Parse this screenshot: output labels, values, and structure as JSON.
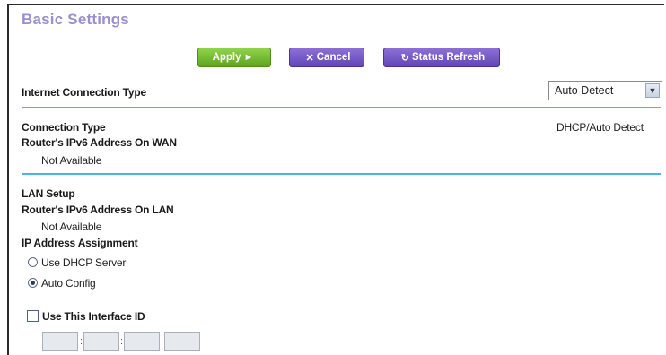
{
  "page": {
    "title": "Basic Settings"
  },
  "toolbar": {
    "apply_label": "Apply",
    "apply_glyph": "►",
    "cancel_label": "Cancel",
    "cancel_glyph": "✕",
    "refresh_label": "Status Refresh",
    "refresh_glyph": "↻"
  },
  "internet_connection": {
    "label": "Internet Connection Type",
    "selected": "Auto Detect",
    "options": [
      "Auto Detect"
    ]
  },
  "wan": {
    "connection_type_label": "Connection Type",
    "connection_type_value": "DHCP/Auto Detect",
    "ipv6_wan_label": "Router's IPv6 Address On WAN",
    "ipv6_wan_value": "Not Available"
  },
  "lan": {
    "section_label": "LAN Setup",
    "ipv6_lan_label": "Router's IPv6 Address On LAN",
    "ipv6_lan_value": "Not Available",
    "ip_assignment_label": "IP Address Assignment",
    "options": [
      {
        "label": "Use DHCP Server",
        "checked": false
      },
      {
        "label": "Auto Config",
        "checked": true
      }
    ]
  },
  "interface_id": {
    "label": "Use This Interface ID",
    "checked": false,
    "fields": [
      "",
      "",
      "",
      ""
    ],
    "separator": ":"
  },
  "colors": {
    "title": "#9a8fcf",
    "apply": "#6fba2c",
    "cancel": "#6a4fbf",
    "divider": "#47b8e0"
  },
  "icons": {
    "dropdown": "chevron-down-icon",
    "apply": "play-arrow-icon",
    "cancel": "close-icon",
    "refresh": "refresh-icon"
  }
}
